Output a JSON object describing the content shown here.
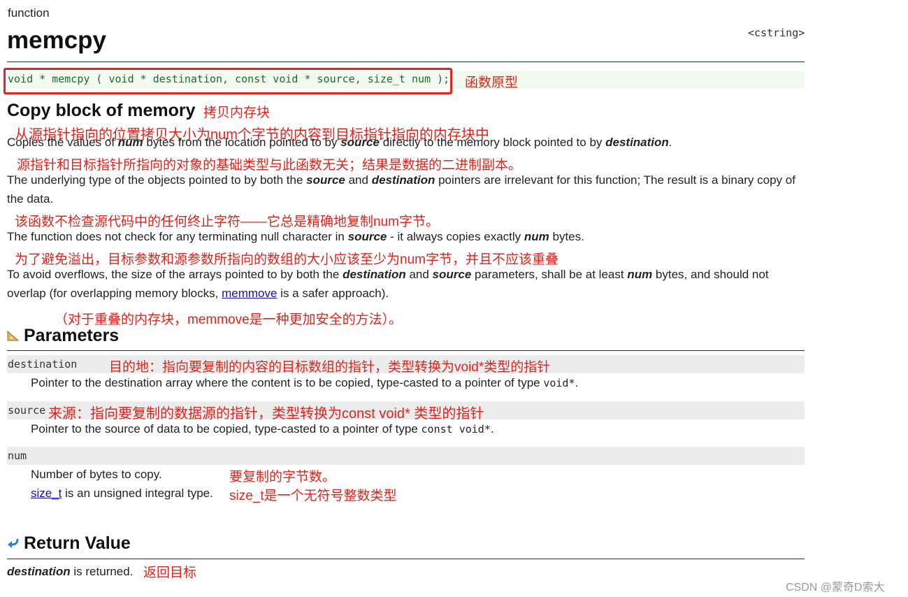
{
  "header": {
    "kind": "function",
    "title": "memcpy",
    "header_file": "<cstring>"
  },
  "prototype": {
    "code": "void * memcpy ( void * destination, const void * source, size_t num );",
    "annotation": "函数原型"
  },
  "description": {
    "heading": "Copy block of memory",
    "heading_annotation": "拷贝内存块",
    "p1_annotation": "从源指针指向的位置拷贝大小为num个字节的内容到目标指针指向的内存块中",
    "p1": {
      "a": "Copies the values of ",
      "num": "num",
      "b": " bytes from the location pointed to by ",
      "source": "source",
      "c": " directly to the memory block pointed to by ",
      "destination": "destination",
      "d": "."
    },
    "p2_annotation": "源指针和目标指针所指向的对象的基础类型与此函数无关；结果是数据的二进制副本。",
    "p2": {
      "a": "The underlying type of the objects pointed to by both the ",
      "source": "source",
      "b": " and ",
      "destination": "destination",
      "c": " pointers are irrelevant for this function; The result is a binary copy of the data."
    },
    "p3_annotation": "该函数不检查源代码中的任何终止字符——它总是精确地复制num字节。",
    "p3": {
      "a": "The function does not check for any terminating null character in ",
      "source": "source",
      "b": " - it always copies exactly ",
      "num": "num",
      "c": " bytes."
    },
    "p4_annotation": "为了避免溢出，目标参数和源参数所指向的数组的大小应该至少为num字节，并且不应该重叠",
    "p4": {
      "a": "To avoid overflows, the size of the arrays pointed to by both the ",
      "destination": "destination",
      "b": " and ",
      "source": "source",
      "c": " parameters, shall be at least ",
      "num": "num",
      "d": " bytes, and should not overlap (for overlapping memory blocks, ",
      "link": "memmove",
      "e": " is a safer approach)."
    },
    "p4_annotation2": "（对于重叠的内存块，memmove是一种更加安全的方法）。"
  },
  "parameters": {
    "heading": "Parameters",
    "items": [
      {
        "name": "destination",
        "annotation": "目的地：指向要复制的内容的目标数组的指针，类型转换为void*类型的指针",
        "desc": "Pointer to the destination array where the content is to be copied, type-casted to a pointer of type ",
        "code": "void*",
        "end": "."
      },
      {
        "name": "source",
        "annotation": "来源：指向要复制的数据源的指针，类型转换为const void* 类型的指针",
        "desc": "Pointer to the source of data to be copied, type-casted to a pointer of type ",
        "code": "const void*",
        "end": "."
      },
      {
        "name": "num",
        "desc": "Number of bytes to copy.",
        "annotation": "要复制的字节数。",
        "link": "size_t",
        "desc2": " is an unsigned integral type.",
        "annotation2": "size_t是一个无符号整数类型"
      }
    ]
  },
  "return_value": {
    "heading": "Return Value",
    "dest": "destination",
    "text": " is returned.",
    "annotation": "返回目标"
  },
  "watermark": "CSDN @蒙奇D索大",
  "colors": {
    "annotation": "#e0231b",
    "rule": "#1b2a4e",
    "proto_bg": "#f3fbf1",
    "proto_text": "#1b6b2a",
    "param_bg": "#ececec",
    "link": "#1a0dab"
  }
}
